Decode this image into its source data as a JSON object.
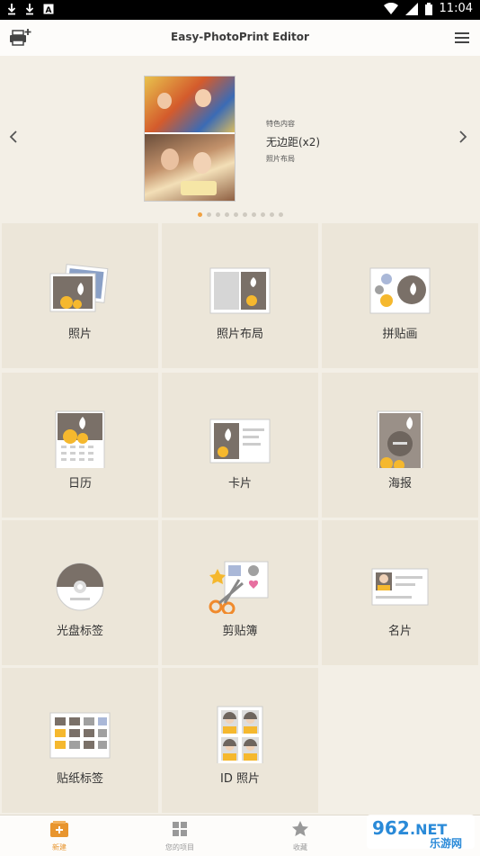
{
  "statusbar": {
    "time": "11:04"
  },
  "appbar": {
    "title": "Easy-PhotoPrint Editor"
  },
  "banner": {
    "category": "特色内容",
    "title": "无边距(x2)",
    "subtitle": "照片布局",
    "dots_total": 10,
    "active_dot": 0
  },
  "tiles": [
    {
      "label": "照片",
      "icon": "photo-icon"
    },
    {
      "label": "照片布局",
      "icon": "photo-layout-icon"
    },
    {
      "label": "拼贴画",
      "icon": "collage-icon"
    },
    {
      "label": "日历",
      "icon": "calendar-icon"
    },
    {
      "label": "卡片",
      "icon": "card-icon"
    },
    {
      "label": "海报",
      "icon": "poster-icon"
    },
    {
      "label": "光盘标签",
      "icon": "disc-label-icon"
    },
    {
      "label": "剪贴簿",
      "icon": "scrapbook-icon"
    },
    {
      "label": "名片",
      "icon": "business-card-icon"
    },
    {
      "label": "贴纸标签",
      "icon": "sticker-label-icon"
    },
    {
      "label": "ID 照片",
      "icon": "id-photo-icon"
    }
  ],
  "bottomnav": {
    "items": [
      {
        "label": "新建",
        "icon": "new-icon"
      },
      {
        "label": "您的项目",
        "icon": "projects-grid-icon"
      },
      {
        "label": "收藏",
        "icon": "star-icon"
      }
    ]
  },
  "watermark": {
    "text1": "962",
    "text2": ".NET",
    "text3": "乐游网"
  },
  "colors": {
    "accent": "#e8952e",
    "tile_bg": "#ece6d9",
    "page_bg": "#f3efe6"
  }
}
